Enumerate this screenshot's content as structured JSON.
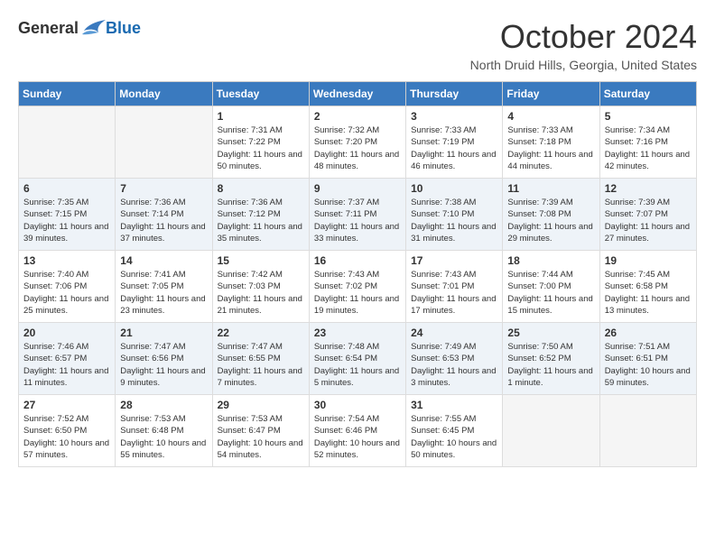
{
  "header": {
    "logo_general": "General",
    "logo_blue": "Blue",
    "month_title": "October 2024",
    "location": "North Druid Hills, Georgia, United States"
  },
  "days_of_week": [
    "Sunday",
    "Monday",
    "Tuesday",
    "Wednesday",
    "Thursday",
    "Friday",
    "Saturday"
  ],
  "weeks": [
    [
      {
        "day": "",
        "info": ""
      },
      {
        "day": "",
        "info": ""
      },
      {
        "day": "1",
        "info": "Sunrise: 7:31 AM\nSunset: 7:22 PM\nDaylight: 11 hours and 50 minutes."
      },
      {
        "day": "2",
        "info": "Sunrise: 7:32 AM\nSunset: 7:20 PM\nDaylight: 11 hours and 48 minutes."
      },
      {
        "day": "3",
        "info": "Sunrise: 7:33 AM\nSunset: 7:19 PM\nDaylight: 11 hours and 46 minutes."
      },
      {
        "day": "4",
        "info": "Sunrise: 7:33 AM\nSunset: 7:18 PM\nDaylight: 11 hours and 44 minutes."
      },
      {
        "day": "5",
        "info": "Sunrise: 7:34 AM\nSunset: 7:16 PM\nDaylight: 11 hours and 42 minutes."
      }
    ],
    [
      {
        "day": "6",
        "info": "Sunrise: 7:35 AM\nSunset: 7:15 PM\nDaylight: 11 hours and 39 minutes."
      },
      {
        "day": "7",
        "info": "Sunrise: 7:36 AM\nSunset: 7:14 PM\nDaylight: 11 hours and 37 minutes."
      },
      {
        "day": "8",
        "info": "Sunrise: 7:36 AM\nSunset: 7:12 PM\nDaylight: 11 hours and 35 minutes."
      },
      {
        "day": "9",
        "info": "Sunrise: 7:37 AM\nSunset: 7:11 PM\nDaylight: 11 hours and 33 minutes."
      },
      {
        "day": "10",
        "info": "Sunrise: 7:38 AM\nSunset: 7:10 PM\nDaylight: 11 hours and 31 minutes."
      },
      {
        "day": "11",
        "info": "Sunrise: 7:39 AM\nSunset: 7:08 PM\nDaylight: 11 hours and 29 minutes."
      },
      {
        "day": "12",
        "info": "Sunrise: 7:39 AM\nSunset: 7:07 PM\nDaylight: 11 hours and 27 minutes."
      }
    ],
    [
      {
        "day": "13",
        "info": "Sunrise: 7:40 AM\nSunset: 7:06 PM\nDaylight: 11 hours and 25 minutes."
      },
      {
        "day": "14",
        "info": "Sunrise: 7:41 AM\nSunset: 7:05 PM\nDaylight: 11 hours and 23 minutes."
      },
      {
        "day": "15",
        "info": "Sunrise: 7:42 AM\nSunset: 7:03 PM\nDaylight: 11 hours and 21 minutes."
      },
      {
        "day": "16",
        "info": "Sunrise: 7:43 AM\nSunset: 7:02 PM\nDaylight: 11 hours and 19 minutes."
      },
      {
        "day": "17",
        "info": "Sunrise: 7:43 AM\nSunset: 7:01 PM\nDaylight: 11 hours and 17 minutes."
      },
      {
        "day": "18",
        "info": "Sunrise: 7:44 AM\nSunset: 7:00 PM\nDaylight: 11 hours and 15 minutes."
      },
      {
        "day": "19",
        "info": "Sunrise: 7:45 AM\nSunset: 6:58 PM\nDaylight: 11 hours and 13 minutes."
      }
    ],
    [
      {
        "day": "20",
        "info": "Sunrise: 7:46 AM\nSunset: 6:57 PM\nDaylight: 11 hours and 11 minutes."
      },
      {
        "day": "21",
        "info": "Sunrise: 7:47 AM\nSunset: 6:56 PM\nDaylight: 11 hours and 9 minutes."
      },
      {
        "day": "22",
        "info": "Sunrise: 7:47 AM\nSunset: 6:55 PM\nDaylight: 11 hours and 7 minutes."
      },
      {
        "day": "23",
        "info": "Sunrise: 7:48 AM\nSunset: 6:54 PM\nDaylight: 11 hours and 5 minutes."
      },
      {
        "day": "24",
        "info": "Sunrise: 7:49 AM\nSunset: 6:53 PM\nDaylight: 11 hours and 3 minutes."
      },
      {
        "day": "25",
        "info": "Sunrise: 7:50 AM\nSunset: 6:52 PM\nDaylight: 11 hours and 1 minute."
      },
      {
        "day": "26",
        "info": "Sunrise: 7:51 AM\nSunset: 6:51 PM\nDaylight: 10 hours and 59 minutes."
      }
    ],
    [
      {
        "day": "27",
        "info": "Sunrise: 7:52 AM\nSunset: 6:50 PM\nDaylight: 10 hours and 57 minutes."
      },
      {
        "day": "28",
        "info": "Sunrise: 7:53 AM\nSunset: 6:48 PM\nDaylight: 10 hours and 55 minutes."
      },
      {
        "day": "29",
        "info": "Sunrise: 7:53 AM\nSunset: 6:47 PM\nDaylight: 10 hours and 54 minutes."
      },
      {
        "day": "30",
        "info": "Sunrise: 7:54 AM\nSunset: 6:46 PM\nDaylight: 10 hours and 52 minutes."
      },
      {
        "day": "31",
        "info": "Sunrise: 7:55 AM\nSunset: 6:45 PM\nDaylight: 10 hours and 50 minutes."
      },
      {
        "day": "",
        "info": ""
      },
      {
        "day": "",
        "info": ""
      }
    ]
  ]
}
